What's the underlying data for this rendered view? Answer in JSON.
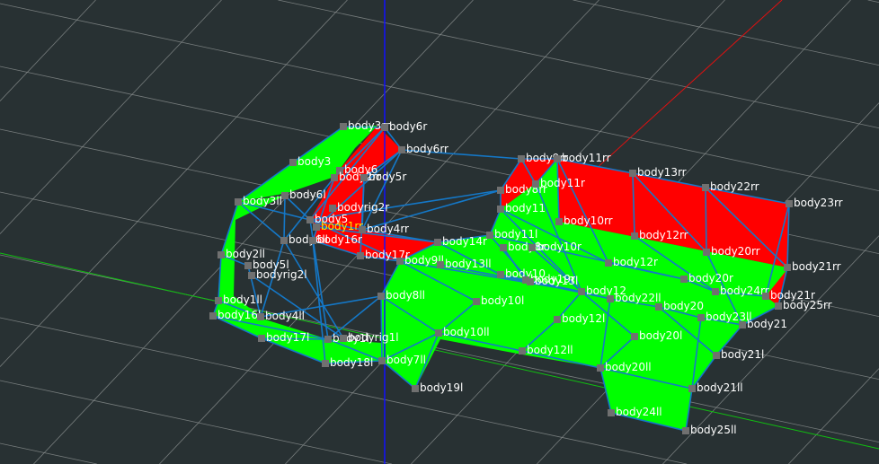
{
  "viewport": {
    "colors": {
      "background": "#283133",
      "grid": "#8a8f8f",
      "x_axis": "#e01010",
      "y_axis": "#10c010",
      "z_axis": "#1010ff",
      "face_green": "#00ff00",
      "face_red": "#ff0000",
      "edge": "#1478c8",
      "node": "#707070"
    },
    "selected_node": "body1rr",
    "nodes": [
      "body3rr",
      "body6r",
      "body6rr",
      "body3",
      "body6",
      "body2rr",
      "body5r",
      "body6l",
      "body3ll",
      "bodyrig2r",
      "body5",
      "body1rr",
      "body4rr",
      "body6ll",
      "body16r",
      "body2ll",
      "body17r",
      "body5l",
      "bodyrig2l",
      "body9ll",
      "body13ll",
      "body14r",
      "body11l",
      "body11",
      "body8rr",
      "body9rr",
      "body11rr",
      "body11r",
      "body13rr",
      "body22rr",
      "body23rr",
      "body10rr",
      "body12rr",
      "body20rr",
      "body21rr",
      "body8r",
      "body10r",
      "body12r",
      "body20r",
      "body24rr",
      "body21r",
      "body25rr",
      "body10",
      "body19r",
      "body13l",
      "body12",
      "body22ll",
      "body20",
      "body23ll",
      "body21",
      "body8ll",
      "body1ll",
      "body16l",
      "body4ll",
      "body10l",
      "body12l",
      "body20l",
      "body17l",
      "body1l",
      "bodyrig1l",
      "body10ll",
      "body12ll",
      "body21l",
      "body18l",
      "body7ll",
      "body20ll",
      "body19l",
      "body21ll",
      "body24ll",
      "body25ll"
    ]
  }
}
